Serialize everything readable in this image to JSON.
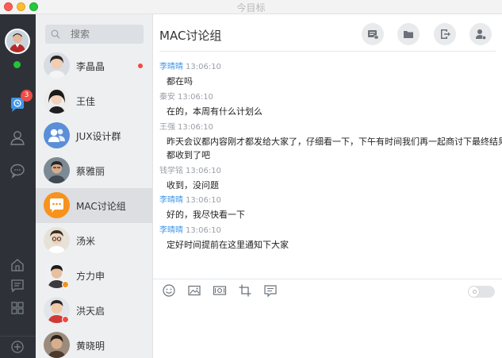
{
  "window": {
    "title": "今目标"
  },
  "colors": {
    "rail_bg": "#2e3238",
    "list_bg": "#eeeff1",
    "accent_blue": "#3e95ea",
    "badge_red": "#f04b45",
    "online_green": "#23c437"
  },
  "rail": {
    "chat_badge": "3",
    "icons": [
      "chat-clock-icon",
      "person-icon",
      "chat-bubble-icon",
      "home-icon",
      "notes-icon",
      "apps-grid-icon",
      "add-circle-icon"
    ]
  },
  "search": {
    "placeholder": "搜索"
  },
  "contacts": [
    {
      "name": "李晶晶",
      "unread": true
    },
    {
      "name": "王佳"
    },
    {
      "name": "JUX设计群"
    },
    {
      "name": "蔡雅丽"
    },
    {
      "name": "MAC讨论组",
      "active": true
    },
    {
      "name": "汤米"
    },
    {
      "name": "方力申"
    },
    {
      "name": "洪天启"
    },
    {
      "name": "黄晓明"
    }
  ],
  "chat": {
    "title": "MAC讨论组",
    "header_actions": [
      "compose-icon",
      "folder-icon",
      "exit-icon",
      "member-settings-icon"
    ],
    "messages": [
      {
        "sender": "李晴晴",
        "time": "13:06:10",
        "lines": [
          "都在吗"
        ],
        "self": true
      },
      {
        "sender": "秦安",
        "time": "13:06:10",
        "lines": [
          "在的，本周有什么计划么"
        ]
      },
      {
        "sender": "王强",
        "time": "13:06:10",
        "lines": [
          "昨天会议都内容刚才都发给大家了，仔细看一下，下午有时间我们再一起商讨下最终结果，",
          "都收到了吧"
        ]
      },
      {
        "sender": "钱学铭",
        "time": "13:06:10",
        "lines": [
          "收到，没问题"
        ]
      },
      {
        "sender": "李晴晴",
        "time": "13:06:10",
        "lines": [
          "好的，我尽快看一下"
        ],
        "self": true
      },
      {
        "sender": "李晴晴",
        "time": "13:06:10",
        "lines": [
          "定好时间提前在这里通知下大家"
        ],
        "self": true
      }
    ],
    "toolbar": [
      "emoji-icon",
      "image-icon",
      "screenshot-icon",
      "crop-icon",
      "message-record-icon"
    ],
    "toggle_on": false
  }
}
